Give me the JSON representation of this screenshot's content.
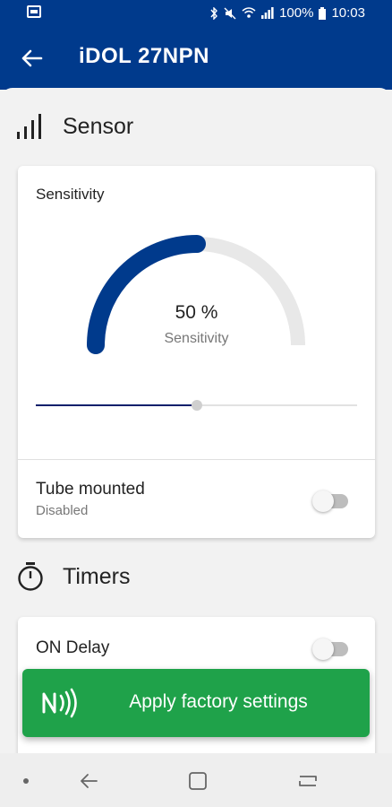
{
  "status": {
    "battery": "100%",
    "time": "10:03"
  },
  "appbar": {
    "title": "iDOL 27NPN"
  },
  "sensor": {
    "title": "Sensor",
    "card": {
      "label": "Sensitivity",
      "gauge_value": "50 %",
      "gauge_caption": "Sensitivity",
      "gauge_percent": 50,
      "slider_percent": 50
    },
    "tube": {
      "title": "Tube mounted",
      "status": "Disabled",
      "enabled": false
    }
  },
  "timers": {
    "title": "Timers",
    "on_delay": {
      "title": "ON Delay",
      "enabled": false
    }
  },
  "fab": {
    "label": "Apply factory settings"
  },
  "colors": {
    "brand_blue": "#003a8c",
    "gauge_fill": "#003a8c",
    "gauge_track": "#e8e8e8",
    "action_green": "#1fa24a"
  },
  "icons": {
    "back": "back-arrow-icon",
    "sensor": "signal-bars-icon",
    "timers": "stopwatch-icon",
    "fab": "nfc-icon",
    "nav_back": "nav-back-icon",
    "nav_home": "nav-home-icon",
    "nav_recent": "nav-recent-icon"
  }
}
